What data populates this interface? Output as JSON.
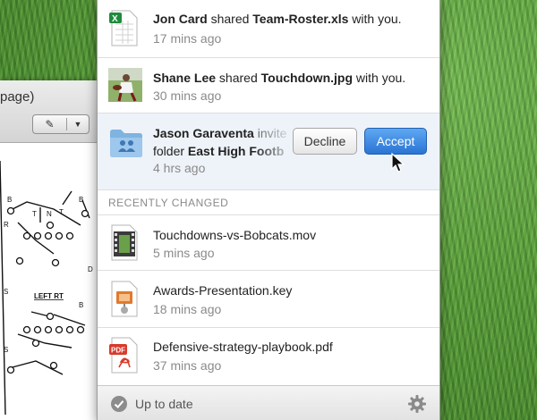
{
  "background_window": {
    "title_fragment": "page)",
    "tool_icon": "highlighter-icon",
    "doc_label": "LEFT RT",
    "doc_letters": [
      "B",
      "T",
      "N",
      "T",
      "B",
      "R",
      "S",
      "D",
      "S",
      "B"
    ]
  },
  "notifications": [
    {
      "user": "Jon Card",
      "action": "shared",
      "item": "Team-Roster.xls",
      "suffix": "with you.",
      "time": "17 mins ago",
      "icon": "spreadsheet-file-icon"
    },
    {
      "user": "Shane Lee",
      "action": "shared",
      "item": "Touchdown.jpg",
      "suffix": "with you.",
      "time": "30 mins ago",
      "icon": "photo-thumbnail"
    }
  ],
  "invite": {
    "user": "Jason Garaventa",
    "action": "invite",
    "prefix": "folder",
    "item": "East High Footb",
    "time": "4 hrs ago",
    "icon": "shared-folder-icon",
    "decline_label": "Decline",
    "accept_label": "Accept"
  },
  "recent": {
    "header": "RECENTLY CHANGED",
    "items": [
      {
        "name": "Touchdowns-vs-Bobcats.mov",
        "time": "5 mins ago",
        "icon": "movie-file-icon"
      },
      {
        "name": "Awards-Presentation.key",
        "time": "18 mins ago",
        "icon": "keynote-file-icon"
      },
      {
        "name": "Defensive-strategy-playbook.pdf",
        "time": "37 mins ago",
        "icon": "pdf-file-icon"
      }
    ]
  },
  "footer": {
    "status": "Up to date",
    "status_icon": "checkmark-icon",
    "settings_icon": "gear-icon"
  },
  "colors": {
    "accent": "#2a74d5",
    "invite_bg": "#eef3f9",
    "muted_text": "#8a8a8a"
  }
}
